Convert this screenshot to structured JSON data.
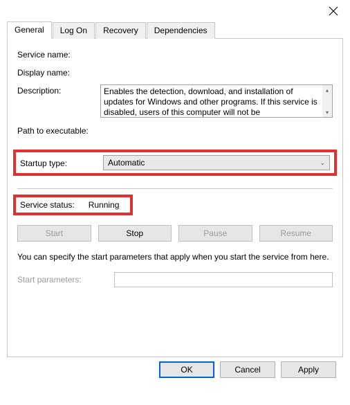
{
  "tabs": {
    "general": "General",
    "logon": "Log On",
    "recovery": "Recovery",
    "dependencies": "Dependencies"
  },
  "labels": {
    "service_name": "Service name:",
    "display_name": "Display name:",
    "description": "Description:",
    "path": "Path to executable:",
    "startup_type": "Startup type:",
    "service_status": "Service status:",
    "start_params": "Start parameters:"
  },
  "values": {
    "service_name": "",
    "display_name": "",
    "description": "Enables the detection, download, and installation of updates for Windows and other programs. If this service is disabled, users of this computer will not be",
    "path": "",
    "startup_type": "Automatic",
    "service_status": "Running",
    "start_params": ""
  },
  "buttons": {
    "start": "Start",
    "stop": "Stop",
    "pause": "Pause",
    "resume": "Resume",
    "ok": "OK",
    "cancel": "Cancel",
    "apply": "Apply"
  },
  "note": "You can specify the start parameters that apply when you start the service from here."
}
